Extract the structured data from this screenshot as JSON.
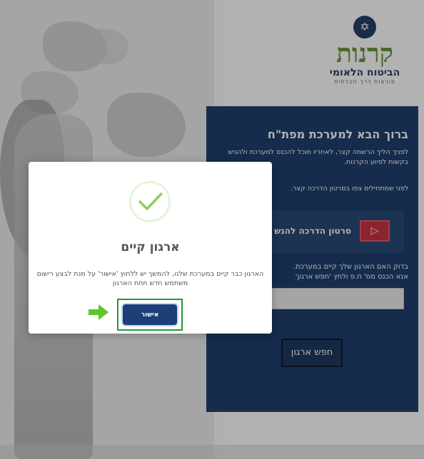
{
  "logo": {
    "brand": "קרנות",
    "org": "הביטוח הלאומי",
    "tagline": "פורצות דרך חברתית"
  },
  "panel": {
    "title": "ברוך הבא למערכת מפת\"ח",
    "intro": "לפניך הליך הרשמה קצר, לאחריו תוכל להכנס למערכת ולהגיש בקשות לסיוע הקרנות.",
    "video_hint": "לפני שמתחילים צפו בסרטון הדרכה קצר.",
    "video_label": "סרטון הדרכה להנש",
    "check_text_1": "בדוק האם הארגון שלך קיים במערכת.",
    "check_text_2": "אנא הכנס מס' ח.פ ולחץ 'חפש ארגון'",
    "search_button": "חפש ארגון"
  },
  "modal": {
    "title": "ארגון קיים",
    "message": "הארגון כבר קיים במערכת שלנו, להמשך יש ללחוץ 'אישור' על מנת לבצע רישום משתמש חדש תחת הארגון",
    "confirm_button": "אישור"
  },
  "colors": {
    "panel": "#20406d",
    "confirm": "#1c3f78",
    "highlight": "#1e9a3a",
    "arrow": "#5cc62a",
    "check": "#8dcf63"
  },
  "icons": [
    "emblem-icon",
    "video-play-icon",
    "checkmark-icon",
    "green-arrow-icon"
  ]
}
